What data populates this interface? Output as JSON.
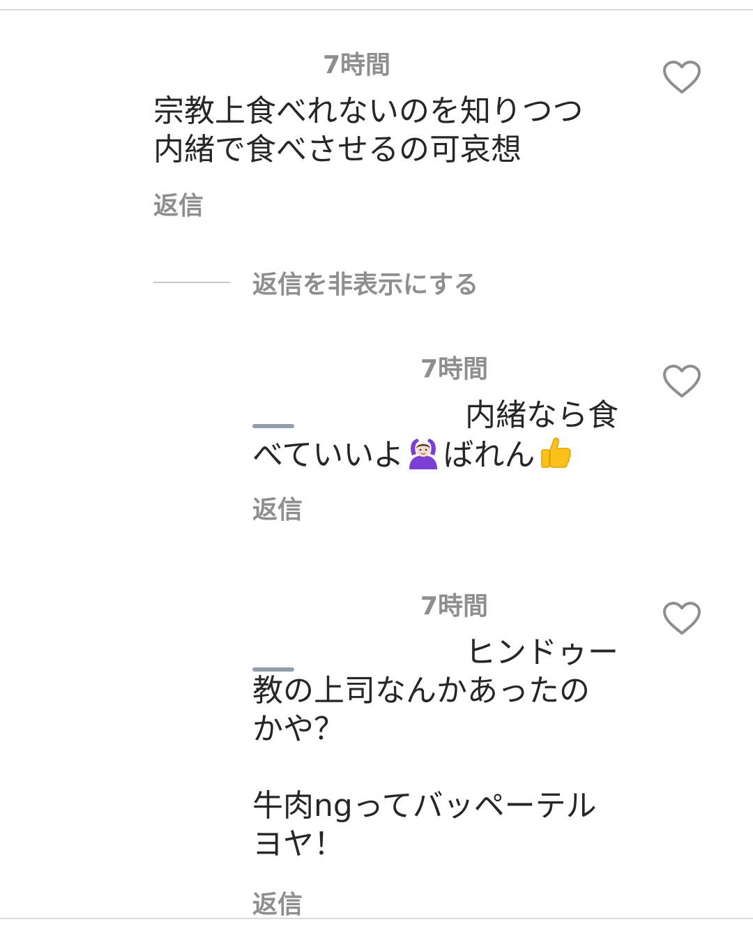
{
  "comments": [
    {
      "timestamp": "7時間",
      "text": "宗教上食べれないのを知りつつ\n内緒で食べさせるの可哀想",
      "reply_label": "返信"
    },
    {
      "timestamp": "7時間",
      "text_line1": "内緒なら食",
      "text_line2a": "べていいよ",
      "emoji1": "person-gesturing-ok-icon",
      "text_line2b": "ばれん",
      "emoji2": "thumbs-up-icon",
      "reply_label": "返信"
    },
    {
      "timestamp": "7時間",
      "text_line1": "ヒンドゥー",
      "text_rest": "教の上司なんかあったの\nかや？\n\n牛肉ngってバッペーテル\nヨヤ！",
      "reply_label": "返信"
    }
  ],
  "hide_replies_label": "返信を非表示にする",
  "colors": {
    "text": "#262626",
    "secondary": "#8e8e8e",
    "divider": "#dbdbdb",
    "heart_outline": "#8e8e8e"
  }
}
